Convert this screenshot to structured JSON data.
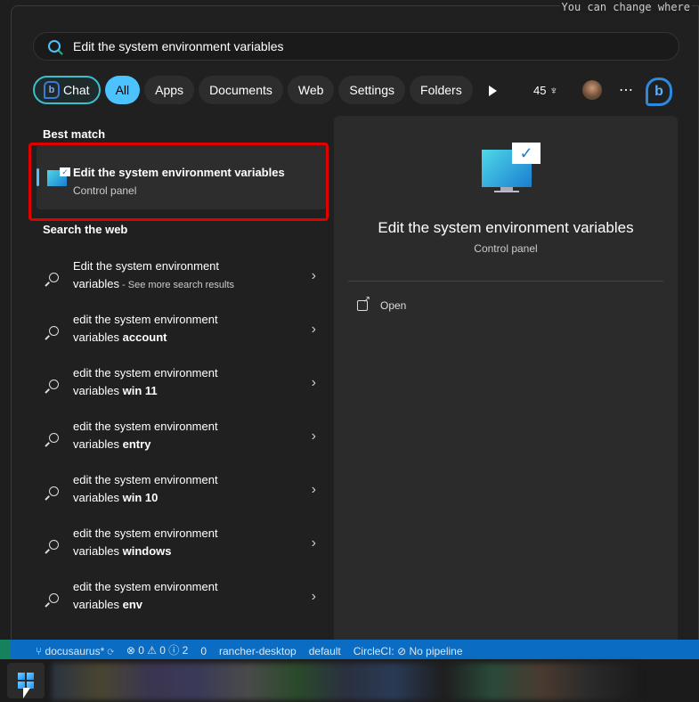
{
  "search": {
    "query": "Edit the system environment variables"
  },
  "filters": [
    {
      "label": "Chat"
    },
    {
      "label": "All"
    },
    {
      "label": "Apps"
    },
    {
      "label": "Documents"
    },
    {
      "label": "Web"
    },
    {
      "label": "Settings"
    },
    {
      "label": "Folders"
    }
  ],
  "rewards_points": "45",
  "best_match": {
    "heading": "Best match",
    "title": "Edit the system environment variables",
    "subtitle": "Control panel"
  },
  "web": {
    "heading": "Search the web",
    "items": [
      {
        "line1": "Edit the system environment",
        "line2": "variables",
        "suffix": " - See more search results"
      },
      {
        "line1": "edit the system environment",
        "line2": "variables ",
        "bold": "account"
      },
      {
        "line1": "edit the system environment",
        "line2": "variables ",
        "bold": "win 11"
      },
      {
        "line1": "edit the system environment",
        "line2": "variables ",
        "bold": "entry"
      },
      {
        "line1": "edit the system environment",
        "line2": "variables ",
        "bold": "win 10"
      },
      {
        "line1": "edit the system environment",
        "line2": "variables ",
        "bold": "windows"
      },
      {
        "line1": "edit the system environment",
        "line2": "variables ",
        "bold": "env"
      }
    ]
  },
  "preview": {
    "title": "Edit the system environment variables",
    "subtitle": "Control panel",
    "open_label": "Open"
  },
  "statusbar": {
    "branch": "docusaurus*",
    "problems": "⊗ 0 ⚠ 0 ⓘ 2",
    "ports": "0",
    "context": "rancher-desktop",
    "namespace": "default",
    "circleci": "CircleCI: ⊘ No pipeline"
  },
  "editor_text": "You can change where",
  "colors": {
    "accent": "#4cc2ff",
    "highlight_box": "#e00000",
    "statusbar": "#0a6cc2"
  }
}
